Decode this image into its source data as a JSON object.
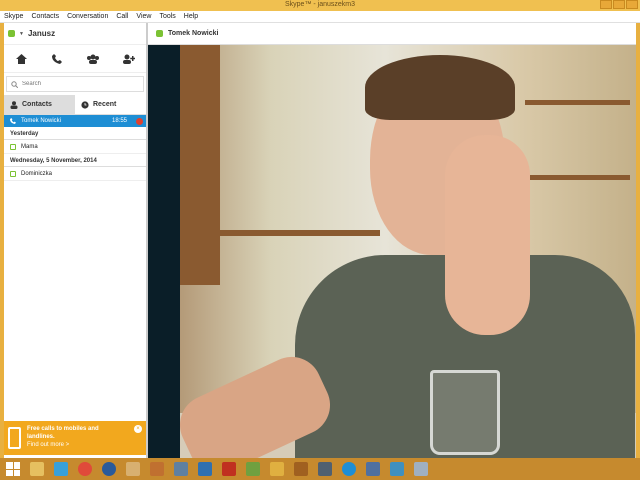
{
  "window": {
    "title": "Skype™ - januszekm3"
  },
  "menu": [
    "Skype",
    "Contacts",
    "Conversation",
    "Call",
    "View",
    "Tools",
    "Help"
  ],
  "profile": {
    "name": "Janusz"
  },
  "search": {
    "placeholder": "Search"
  },
  "tabs": {
    "contacts": "Contacts",
    "recent": "Recent"
  },
  "recent": {
    "active_call": {
      "name": "Tomek Nowicki",
      "time": "18:55"
    },
    "groups": [
      {
        "header": "Yesterday",
        "items": [
          "Mama"
        ]
      },
      {
        "header": "Wednesday, 5 November, 2014",
        "items": [
          "Dominiczka"
        ]
      }
    ]
  },
  "promo": {
    "text": "Free calls to mobiles and landlines.",
    "link": "Find out more >"
  },
  "conversation": {
    "contact_name": "Tomek Nowicki"
  },
  "colors": {
    "skype_blue": "#1e8ed4",
    "online_green": "#7bc233",
    "promo_orange": "#f2a81e",
    "end_call_red": "#e04030"
  }
}
